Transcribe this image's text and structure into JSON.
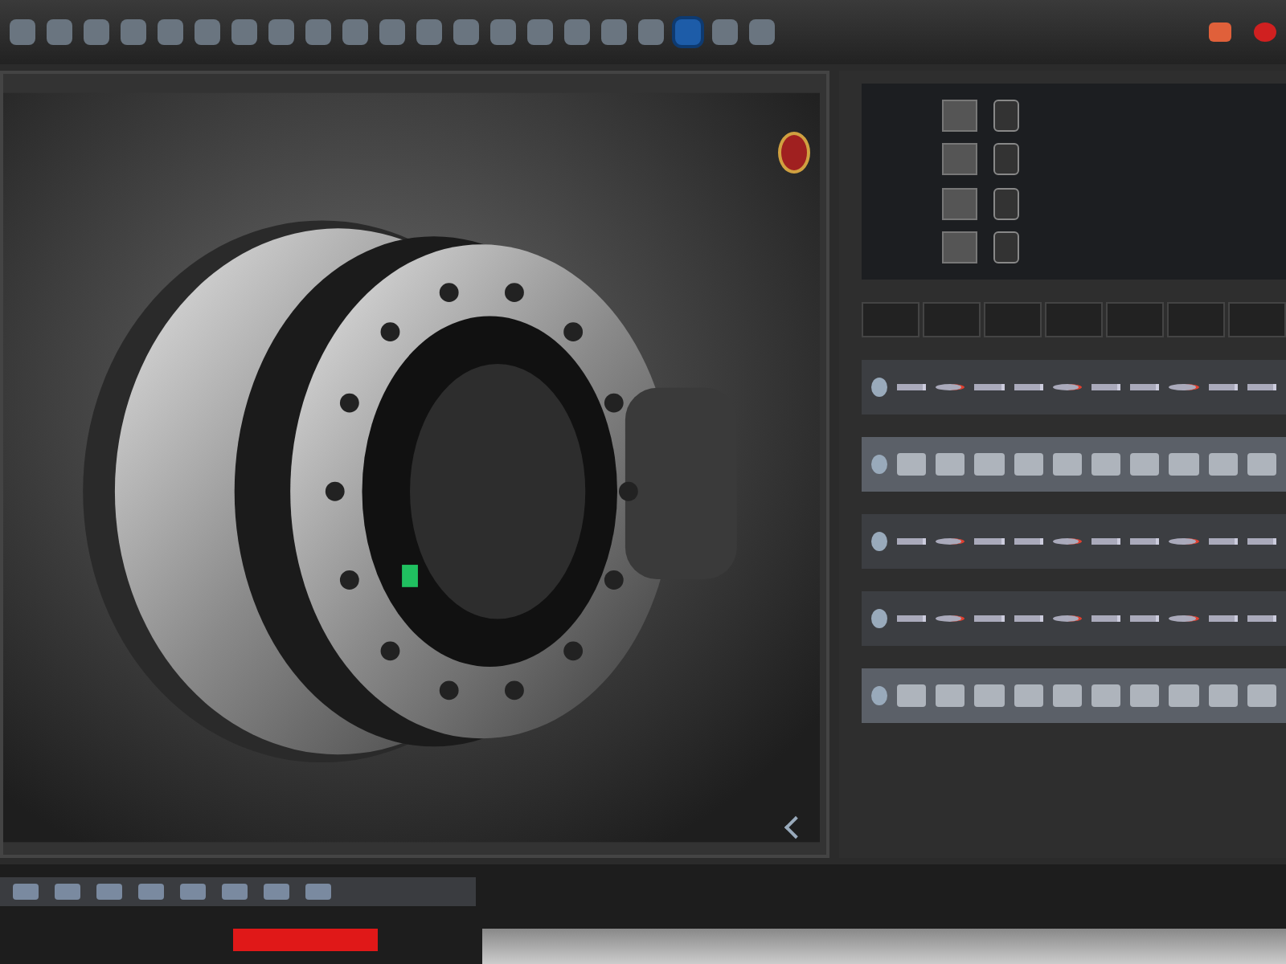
{
  "toolbar": {
    "icons": [
      {
        "selected": false
      },
      {
        "selected": false
      },
      {
        "selected": false
      },
      {
        "selected": false
      },
      {
        "selected": false
      },
      {
        "selected": false
      },
      {
        "selected": false
      },
      {
        "selected": false
      },
      {
        "selected": false
      },
      {
        "selected": false
      },
      {
        "selected": false
      },
      {
        "selected": false
      },
      {
        "selected": false
      },
      {
        "selected": false
      },
      {
        "selected": false
      },
      {
        "selected": false
      },
      {
        "selected": false
      },
      {
        "selected": false
      },
      {
        "selected": true
      },
      {
        "selected": false
      },
      {
        "selected": false
      }
    ]
  },
  "tracks": [
    {
      "kind": "keys"
    },
    {
      "kind": "thumbs"
    },
    {
      "kind": "keys"
    },
    {
      "kind": "keys"
    },
    {
      "kind": "thumbs"
    }
  ]
}
